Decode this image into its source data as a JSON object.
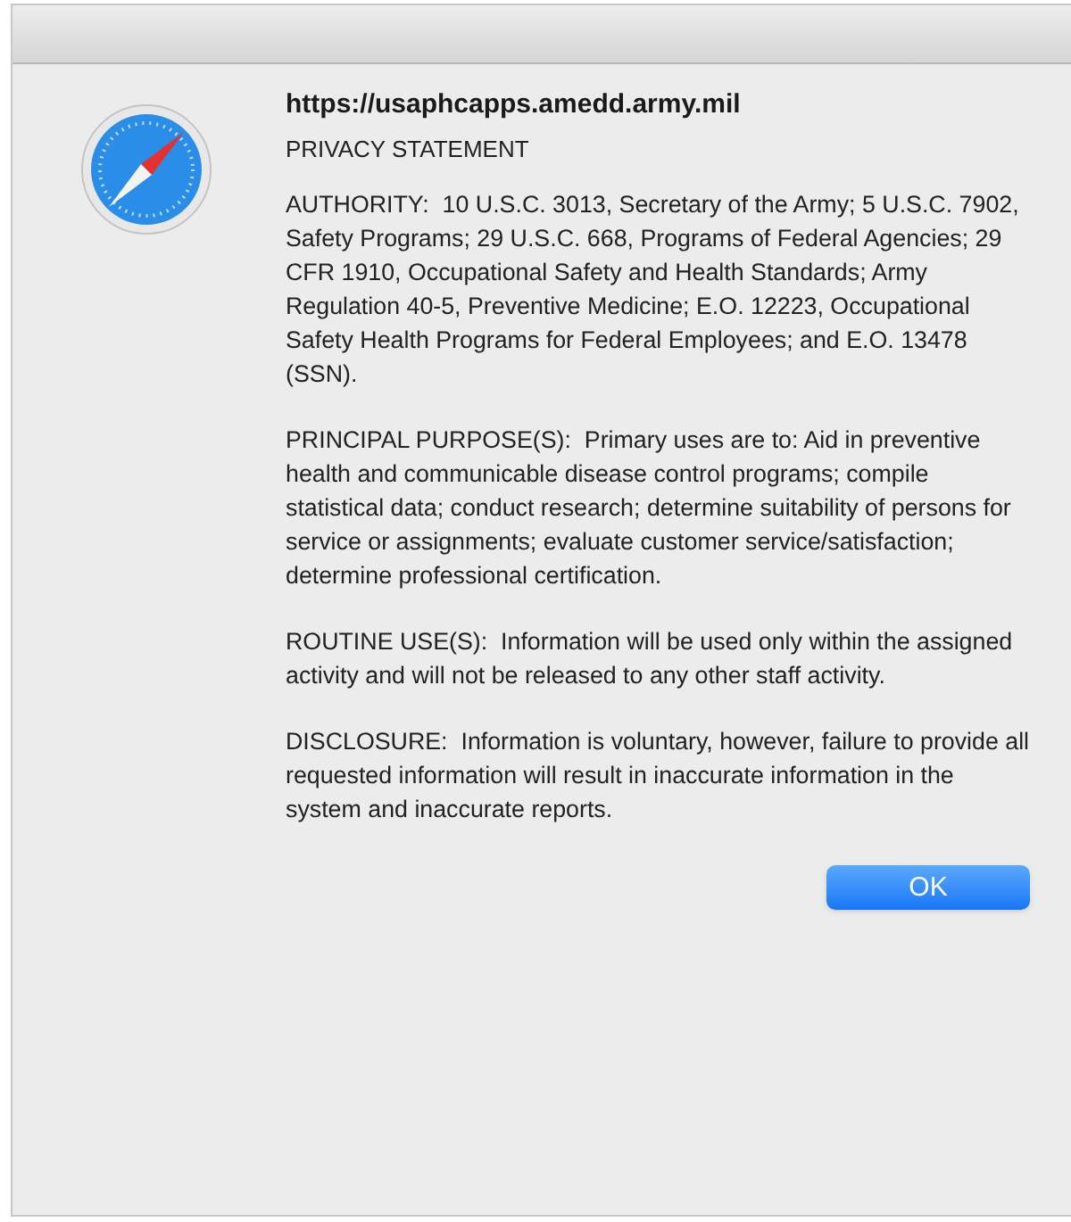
{
  "dialog": {
    "site": "https://usaphcapps.amedd.army.mil",
    "heading": "PRIVACY STATEMENT",
    "paragraphs": [
      "AUTHORITY:  10 U.S.C. 3013, Secretary of the Army; 5 U.S.C. 7902, Safety Programs; 29 U.S.C. 668, Programs of Federal Agencies; 29 CFR 1910, Occupational Safety and Health Standards; Army Regulation 40-5, Preventive Medicine; E.O. 12223, Occupational Safety Health Programs for Federal Employees; and E.O. 13478 (SSN).",
      "PRINCIPAL PURPOSE(S):  Primary uses are to: Aid in preventive health and communicable disease control programs; compile statistical data; conduct research; determine suitability of persons for service or assignments; evaluate customer service/satisfaction; determine professional certification.",
      "ROUTINE USE(S):  Information will be used only within the assigned activity and will not be released to any other staff activity.",
      "DISCLOSURE:  Information is voluntary, however, failure to provide all requested information will result in inaccurate information in the system and inaccurate reports."
    ],
    "button": "OK"
  }
}
